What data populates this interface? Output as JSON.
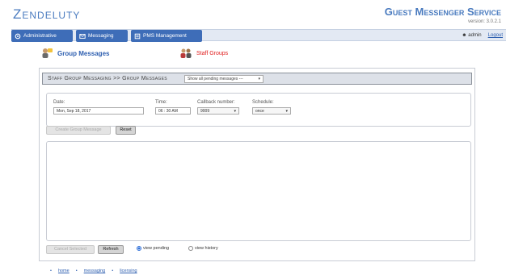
{
  "header": {
    "brand": "Zendeluty",
    "product": "Guest Messenger Service",
    "version": "version: 3.0.2.1"
  },
  "nav": {
    "items": [
      {
        "label": "Administrative",
        "icon": "admin-icon"
      },
      {
        "label": "Messaging",
        "icon": "messaging-icon"
      },
      {
        "label": "PMS Management",
        "icon": "pms-icon"
      }
    ],
    "user": "admin",
    "logout": "Logout"
  },
  "sections": {
    "group_messages": "Group Messages",
    "staff_groups": "Staff Groups"
  },
  "panel": {
    "title": "Staff Group Messaging >> Group Messages",
    "filter": "Show all pending messages ---",
    "form": {
      "date_label": "Date:",
      "date_value": "Mon, Sep 18, 2017",
      "time_label": "Time:",
      "time_value": "06 : 30 AM",
      "callback_label": "Callback number:",
      "callback_value": "9009",
      "schedule_label": "Schedule:",
      "schedule_value": "once"
    },
    "buttons": {
      "create": "Create Group Message",
      "reset": "Reset",
      "cancel": "Cancel Selected",
      "refresh": "Refresh"
    },
    "view": {
      "pending": "view pending",
      "history": "view history",
      "selected": "pending"
    }
  },
  "footer": {
    "links": [
      "home",
      "messaging",
      "licensing"
    ]
  }
}
